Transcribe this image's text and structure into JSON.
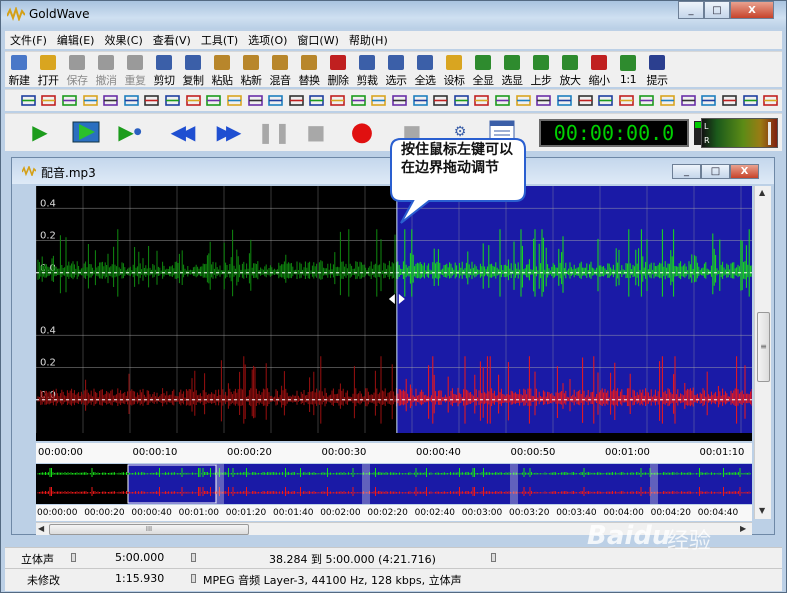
{
  "window": {
    "title": "GoldWave",
    "min": "_",
    "max": "□",
    "close": "X"
  },
  "menu": [
    "文件(F)",
    "编辑(E)",
    "效果(C)",
    "查看(V)",
    "工具(T)",
    "选项(O)",
    "窗口(W)",
    "帮助(H)"
  ],
  "toolbar": [
    {
      "label": "新建",
      "icon": "new-file-icon",
      "color": "#4a78c8",
      "enabled": true
    },
    {
      "label": "打开",
      "icon": "open-folder-icon",
      "color": "#d9a520",
      "enabled": true
    },
    {
      "label": "保存",
      "icon": "save-disk-icon",
      "color": "#9a9a9a",
      "enabled": false
    },
    {
      "label": "撤消",
      "icon": "undo-arrow-icon",
      "color": "#9a9a9a",
      "enabled": false
    },
    {
      "label": "重复",
      "icon": "redo-arrow-icon",
      "color": "#9a9a9a",
      "enabled": false
    },
    {
      "label": "剪切",
      "icon": "scissors-icon",
      "color": "#3b5fa8",
      "enabled": true
    },
    {
      "label": "复制",
      "icon": "copy-icon",
      "color": "#3b5fa8",
      "enabled": true
    },
    {
      "label": "粘贴",
      "icon": "paste-icon",
      "color": "#b8862b",
      "enabled": true
    },
    {
      "label": "粘新",
      "icon": "paste-new-icon",
      "color": "#b8862b",
      "enabled": true
    },
    {
      "label": "混音",
      "icon": "mix-icon",
      "color": "#b8862b",
      "enabled": true
    },
    {
      "label": "替换",
      "icon": "replace-icon",
      "color": "#b8862b",
      "enabled": true
    },
    {
      "label": "删除",
      "icon": "delete-icon",
      "color": "#c02020",
      "enabled": true
    },
    {
      "label": "剪裁",
      "icon": "trim-icon",
      "color": "#3b5fa8",
      "enabled": true
    },
    {
      "label": "选示",
      "icon": "select-view-icon",
      "color": "#3b5fa8",
      "enabled": true
    },
    {
      "label": "全选",
      "icon": "select-all-icon",
      "color": "#3b5fa8",
      "enabled": true
    },
    {
      "label": "设标",
      "icon": "set-marker-icon",
      "color": "#d9a520",
      "enabled": true
    },
    {
      "label": "全显",
      "icon": "zoom-all-icon",
      "color": "#2e8b2e",
      "enabled": true
    },
    {
      "label": "选显",
      "icon": "zoom-selection-icon",
      "color": "#2e8b2e",
      "enabled": true
    },
    {
      "label": "上步",
      "icon": "zoom-previous-icon",
      "color": "#2e8b2e",
      "enabled": true
    },
    {
      "label": "放大",
      "icon": "zoom-in-icon",
      "color": "#2e8b2e",
      "enabled": true
    },
    {
      "label": "缩小",
      "icon": "zoom-out-icon",
      "color": "#c02020",
      "enabled": true
    },
    {
      "label": "1:1",
      "icon": "zoom-1to1-icon",
      "color": "#2e8b2e",
      "enabled": true
    },
    {
      "label": "提示",
      "icon": "hint-arrow-icon",
      "color": "#2b3f8f",
      "enabled": true
    }
  ],
  "toolbar2_count": 37,
  "transport": {
    "time": "00:00:00.0",
    "meter_left": "L",
    "meter_right": "R"
  },
  "document": {
    "title": "配音.mp3"
  },
  "waveform": {
    "y_labels": [
      "0.4",
      "0.2",
      "0.0"
    ],
    "ruler": [
      "00:00:00",
      "00:00:10",
      "00:00:20",
      "00:00:30",
      "00:00:40",
      "00:00:50",
      "00:01:00",
      "00:01:10"
    ],
    "overview_ruler": [
      "00:00:00",
      "00:00:20",
      "00:00:40",
      "00:01:00",
      "00:01:20",
      "00:01:40",
      "00:02:00",
      "00:02:20",
      "00:02:40",
      "00:03:00",
      "00:03:20",
      "00:03:40",
      "00:04:00",
      "00:04:20",
      "00:04:40"
    ],
    "selection_start_fraction": 0.504
  },
  "callout": {
    "text": "按住鼠标左键可以在边界拖动调节"
  },
  "status": {
    "row1": {
      "channels": "立体声",
      "length": "5:00.000",
      "range": "38.284 到 5:00.000 (4:21.716)"
    },
    "row2": {
      "modified": "未修改",
      "position": "1:15.930",
      "format": "MPEG 音频 Layer-3, 44100 Hz, 128 kbps, 立体声"
    }
  },
  "watermark": {
    "brand": "Baidu",
    "label": "经验"
  }
}
